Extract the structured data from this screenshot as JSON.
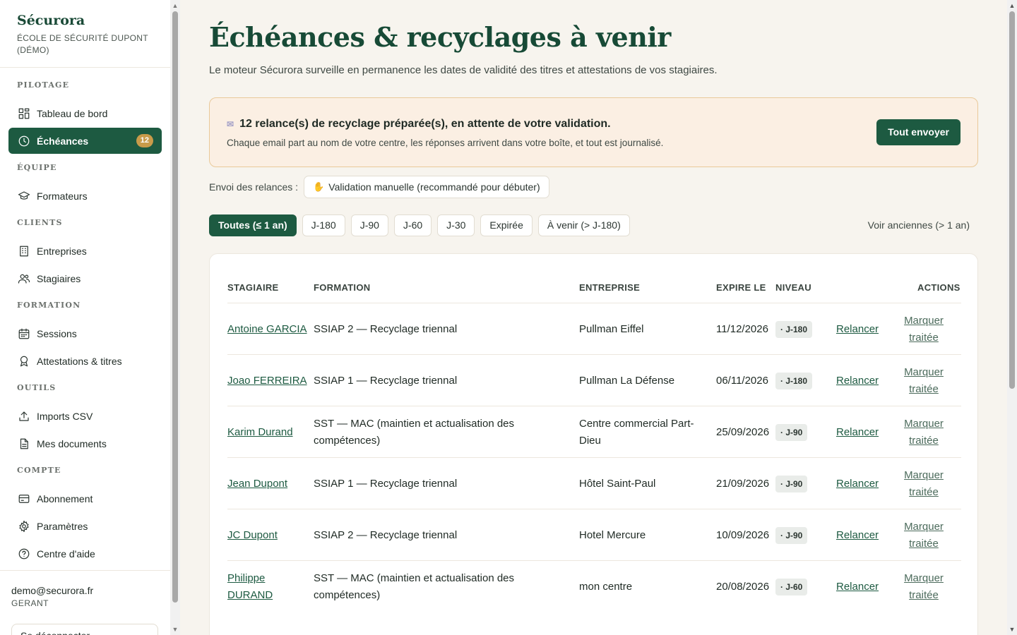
{
  "brand": {
    "name": "Sécurora",
    "subtitle": "ÉCOLE DE SÉCURITÉ DUPONT (DÉMO)"
  },
  "nav": {
    "sections": [
      {
        "label": "PILOTAGE",
        "items": [
          {
            "label": "Tableau de bord",
            "icon": "dashboard-icon"
          },
          {
            "label": "Échéances",
            "icon": "clock-icon",
            "active": true,
            "badge": "12"
          }
        ]
      },
      {
        "label": "ÉQUIPE",
        "items": [
          {
            "label": "Formateurs",
            "icon": "graduation-cap-icon"
          }
        ]
      },
      {
        "label": "CLIENTS",
        "items": [
          {
            "label": "Entreprises",
            "icon": "building-icon"
          },
          {
            "label": "Stagiaires",
            "icon": "users-icon"
          }
        ]
      },
      {
        "label": "FORMATION",
        "items": [
          {
            "label": "Sessions",
            "icon": "calendar-icon"
          },
          {
            "label": "Attestations & titres",
            "icon": "award-icon"
          }
        ]
      },
      {
        "label": "OUTILS",
        "items": [
          {
            "label": "Imports CSV",
            "icon": "upload-icon"
          },
          {
            "label": "Mes documents",
            "icon": "document-icon"
          }
        ]
      },
      {
        "label": "COMPTE",
        "items": [
          {
            "label": "Abonnement",
            "icon": "credit-card-icon"
          },
          {
            "label": "Paramètres",
            "icon": "gear-icon"
          },
          {
            "label": "Centre d'aide",
            "icon": "help-icon"
          }
        ]
      }
    ]
  },
  "user": {
    "email": "demo@securora.fr",
    "role": "GERANT",
    "logout_label": "Se déconnecter"
  },
  "page": {
    "title": "Échéances & recyclages à venir",
    "description": "Le moteur Sécurora surveille en permanence les dates de validité des titres et attestations de vos stagiaires."
  },
  "alert": {
    "title": "12 relance(s) de recyclage préparée(s), en attente de votre validation.",
    "text": "Chaque email part au nom de votre centre, les réponses arrivent dans votre boîte, et tout est journalisé.",
    "button": "Tout envoyer",
    "icon": "envelope-icon"
  },
  "send_mode": {
    "label": "Envoi des relances :",
    "value": "Validation manuelle (recommandé pour débuter)",
    "icon": "hand-icon"
  },
  "filters": {
    "chips": [
      "Toutes (≤ 1 an)",
      "J-180",
      "J-90",
      "J-60",
      "J-30",
      "Expirée",
      "À venir (> J-180)"
    ],
    "active_index": 0,
    "old_link": "Voir anciennes (> 1 an)"
  },
  "table": {
    "headers": {
      "stagiaire": "STAGIAIRE",
      "formation": "FORMATION",
      "entreprise": "ENTREPRISE",
      "expire": "EXPIRE LE",
      "niveau": "NIVEAU",
      "actions": "ACTIONS"
    },
    "action_relancer": "Relancer",
    "action_marquer": "Marquer traitée",
    "rows": [
      {
        "stagiaire": "Antoine GARCIA",
        "formation": "SSIAP 2 — Recyclage triennal",
        "entreprise": "Pullman Eiffel",
        "expire": "11/12/2026",
        "niveau": "· J-180"
      },
      {
        "stagiaire": "Joao FERREIRA",
        "formation": "SSIAP 1 — Recyclage triennal",
        "entreprise": "Pullman La Défense",
        "expire": "06/11/2026",
        "niveau": "· J-180"
      },
      {
        "stagiaire": "Karim Durand",
        "formation": "SST — MAC (maintien et actualisation des compétences)",
        "entreprise": "Centre commercial Part-Dieu",
        "expire": "25/09/2026",
        "niveau": "· J-90"
      },
      {
        "stagiaire": "Jean Dupont",
        "formation": "SSIAP 1 — Recyclage triennal",
        "entreprise": "Hôtel Saint-Paul",
        "expire": "21/09/2026",
        "niveau": "· J-90"
      },
      {
        "stagiaire": "JC Dupont",
        "formation": "SSIAP 2 — Recyclage triennal",
        "entreprise": "Hotel Mercure",
        "expire": "10/09/2026",
        "niveau": "· J-90"
      },
      {
        "stagiaire": "Philippe DURAND",
        "formation": "SST — MAC (maintien et actualisation des compétences)",
        "entreprise": "mon centre",
        "expire": "20/08/2026",
        "niveau": "· J-60"
      }
    ]
  },
  "colors": {
    "brand_green": "#1d5a41",
    "badge_gold": "#c99b4a",
    "alert_bg": "#fbefe3",
    "alert_border": "#e9c99a"
  }
}
